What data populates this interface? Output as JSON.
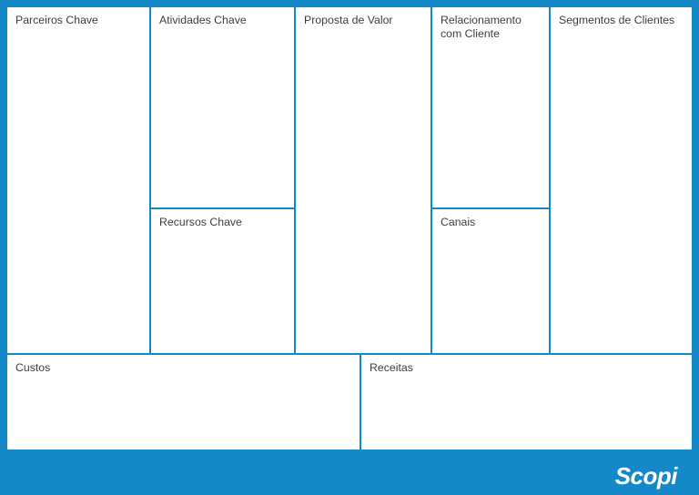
{
  "canvas": {
    "key_partners": "Parceiros Chave",
    "key_activities": "Atividades Chave",
    "key_resources": "Recursos Chave",
    "value_proposition": "Proposta de Valor",
    "customer_relationships": "Relacionamento com Cliente",
    "channels": "Canais",
    "customer_segments": "Segmentos de Clientes",
    "costs": "Custos",
    "revenue": "Receitas"
  },
  "brand": "Scopi",
  "colors": {
    "frame_blue": "#1488c8",
    "text": "#3d3d3d",
    "cell_bg": "#ffffff"
  }
}
